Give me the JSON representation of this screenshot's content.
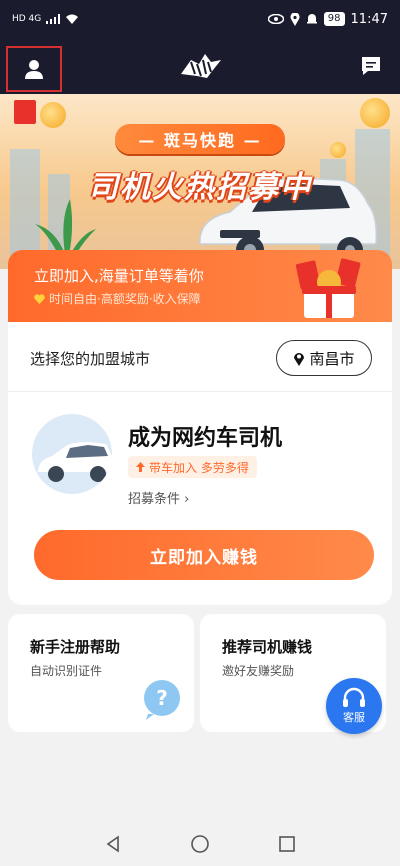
{
  "status_bar": {
    "network": "HD 4G",
    "battery": "98",
    "time": "11:47"
  },
  "banner": {
    "ribbon_text": "— 斑马快跑 —",
    "title": "司机火热招募中"
  },
  "promo": {
    "title": "立即加入,海量订单等着你",
    "subtitle": "时间自由·高额奖励·收入保障"
  },
  "city": {
    "label": "选择您的加盟城市",
    "value": "南昌市"
  },
  "driver": {
    "title": "成为网约车司机",
    "tag": "带车加入 多劳多得",
    "link": "招募条件 ›",
    "join_button": "立即加入赚钱"
  },
  "cards": [
    {
      "title": "新手注册帮助",
      "subtitle": "自动识别证件"
    },
    {
      "title": "推荐司机赚钱",
      "subtitle": "邀好友赚奖励"
    }
  ],
  "service_button": "客服",
  "colors": {
    "header_bg": "#1a1c2e",
    "accent_orange": "#ff6a2b",
    "service_blue": "#2b77f0"
  }
}
